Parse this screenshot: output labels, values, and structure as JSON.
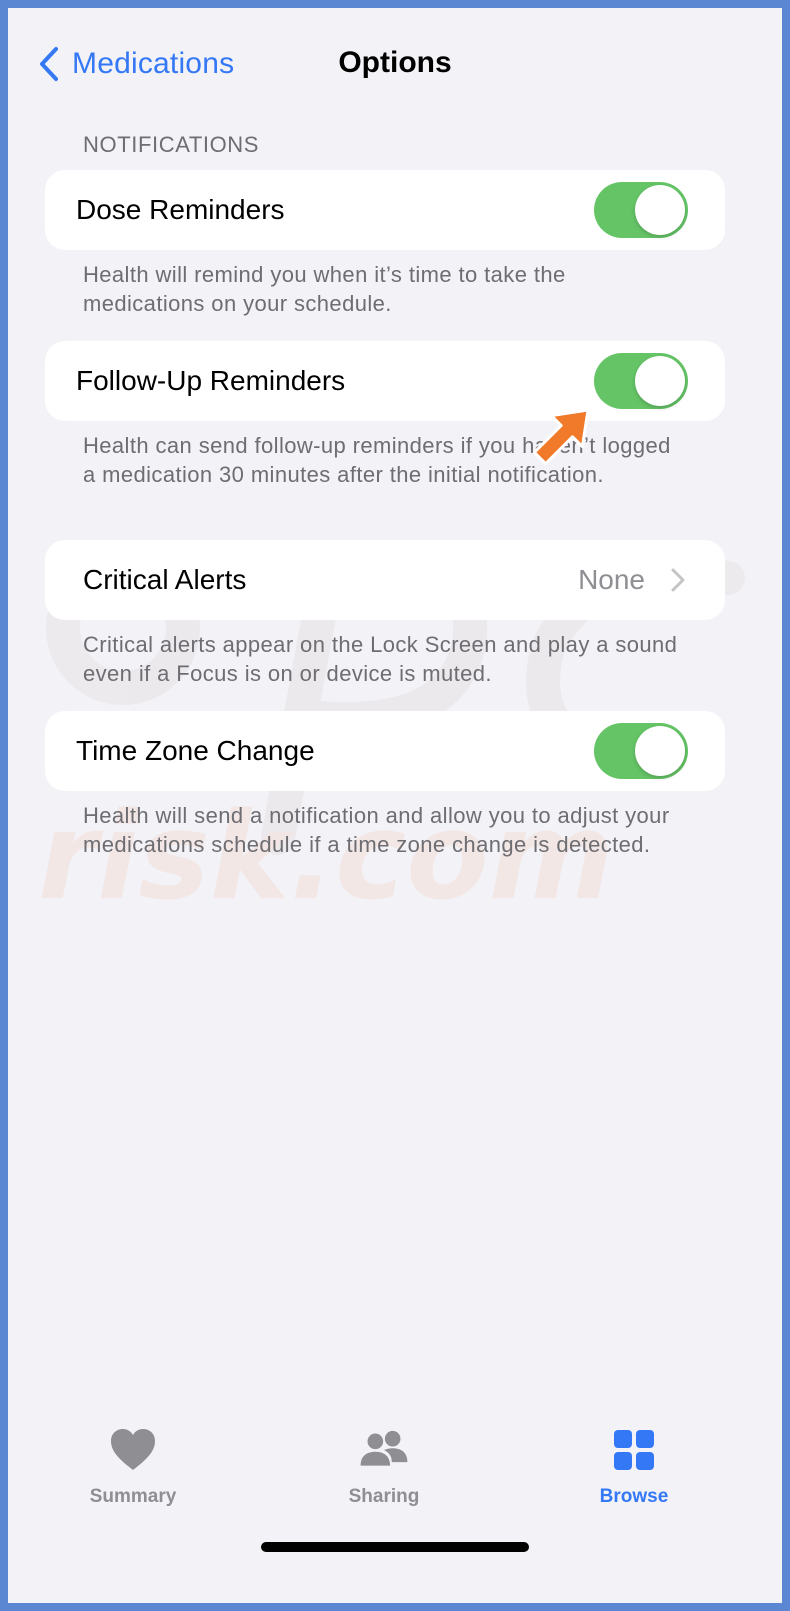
{
  "nav": {
    "back_label": "Medications",
    "title": "Options"
  },
  "section_header": "NOTIFICATIONS",
  "rows": [
    {
      "label": "Dose Reminders",
      "toggle_on": true,
      "footnote": "Health will remind you when it’s time to take the medications on your schedule."
    },
    {
      "label": "Follow-Up Reminders",
      "toggle_on": true,
      "footnote": "Health can send follow-up reminders if you haven’t logged a medication 30 minutes after the initial notification."
    },
    {
      "label": "Critical Alerts",
      "value": "None",
      "footnote": "Critical alerts appear on the Lock Screen and play a sound even if a Focus is on or device is muted."
    },
    {
      "label": "Time Zone Change",
      "toggle_on": true,
      "footnote": "Health will send a notification and allow you to adjust your medications schedule if a time zone change is detected."
    }
  ],
  "tabs": [
    {
      "label": "Summary",
      "icon": "heart-icon",
      "active": false
    },
    {
      "label": "Sharing",
      "icon": "people-icon",
      "active": false
    },
    {
      "label": "Browse",
      "icon": "grid-icon",
      "active": true
    }
  ],
  "colors": {
    "accent": "#3478f6",
    "toggle_on": "#65c466",
    "background": "#f2f2f7",
    "annotation_arrow": "#f07a2a",
    "frame_border": "#5b86d2"
  }
}
